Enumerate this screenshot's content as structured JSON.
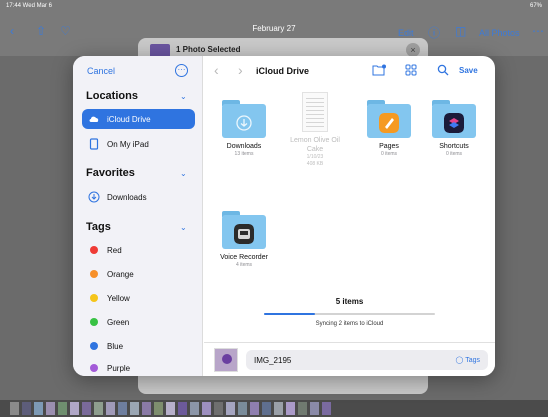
{
  "status_bar": {
    "time": "17:44  Wed Mar 6",
    "battery": "67%"
  },
  "photos_toolbar": {
    "date": "February 27",
    "edit": "Edit",
    "all_photos": "All Photos"
  },
  "background_sheet": {
    "title": "1 Photo Selected"
  },
  "picker": {
    "cancel": "Cancel",
    "location_title": "iCloud Drive",
    "save": "Save",
    "sidebar": {
      "locations_header": "Locations",
      "locations": [
        {
          "label": "iCloud Drive",
          "selected": true
        },
        {
          "label": "On My iPad",
          "selected": false
        }
      ],
      "favorites_header": "Favorites",
      "favorites": [
        {
          "label": "Downloads"
        }
      ],
      "tags_header": "Tags",
      "tags": [
        {
          "label": "Red",
          "color": "#ef3b36"
        },
        {
          "label": "Orange",
          "color": "#f7902a"
        },
        {
          "label": "Yellow",
          "color": "#f5c51a"
        },
        {
          "label": "Green",
          "color": "#38c244"
        },
        {
          "label": "Blue",
          "color": "#2f74e0"
        },
        {
          "label": "Purple",
          "color": "#a35bd8"
        }
      ]
    },
    "items": [
      {
        "name": "Downloads",
        "meta": "13 items",
        "kind": "folder"
      },
      {
        "name": "Lemon Olive Oil Cake",
        "meta": "1/10/23",
        "meta2": "408 KB",
        "kind": "document"
      },
      {
        "name": "Pages",
        "meta": "0 items",
        "kind": "folder"
      },
      {
        "name": "Shortcuts",
        "meta": "0 items",
        "kind": "folder"
      },
      {
        "name": "Voice Recorder",
        "meta": "4 items",
        "kind": "folder"
      }
    ],
    "count": "5 items",
    "sync_progress": 0.3,
    "sync_status": "Syncing 2 items to iCloud",
    "filename": "IMG_2195",
    "tags_button": "Tags"
  },
  "colors": {
    "accent": "#2f74e0",
    "folder": "#83c6ef"
  }
}
